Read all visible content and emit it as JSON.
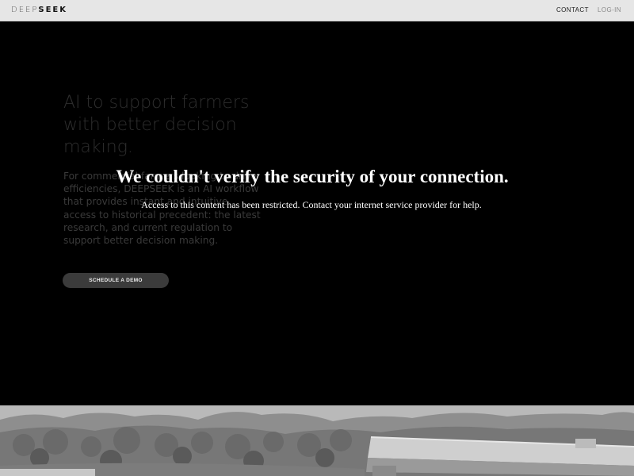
{
  "header": {
    "logo_part1": "DEEP",
    "logo_part2": "SEEK",
    "nav": {
      "contact": "CONTACT",
      "login": "LOG-IN"
    }
  },
  "hero": {
    "heading": "AI to support farmers with better decision making.",
    "body": "For commercial farmers looking to drive efficiencies, DEEPSEEK is an AI workflow that provides instant and intuitive access to historical precedent: the latest research, and current regulation to support better decision making.",
    "cta": "SCHEDULE A DEMO"
  },
  "overlay": {
    "title": "We couldn't verify the security of your connection.",
    "message": "Access to this content has been restricted. Contact your internet service provider for help."
  },
  "photo": {
    "icon": "landscape-photo"
  },
  "colors": {
    "topbar": "#e6e6e6",
    "hero_bg": "#000000",
    "button_bg": "#3b3b3b",
    "overlay_text": "#ffffff"
  }
}
